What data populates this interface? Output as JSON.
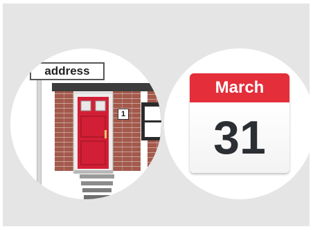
{
  "cards": {
    "address": {
      "sign_label": "address",
      "house_number": "1",
      "icon": "house-front-door-illustration"
    },
    "date": {
      "month": "March",
      "day": "31",
      "icon": "calendar-icon"
    }
  },
  "colors": {
    "panel_bg": "#e5e5e5",
    "calendar_header": "#e42e3a",
    "door": "#d31f35",
    "brick": "#a3594b"
  }
}
